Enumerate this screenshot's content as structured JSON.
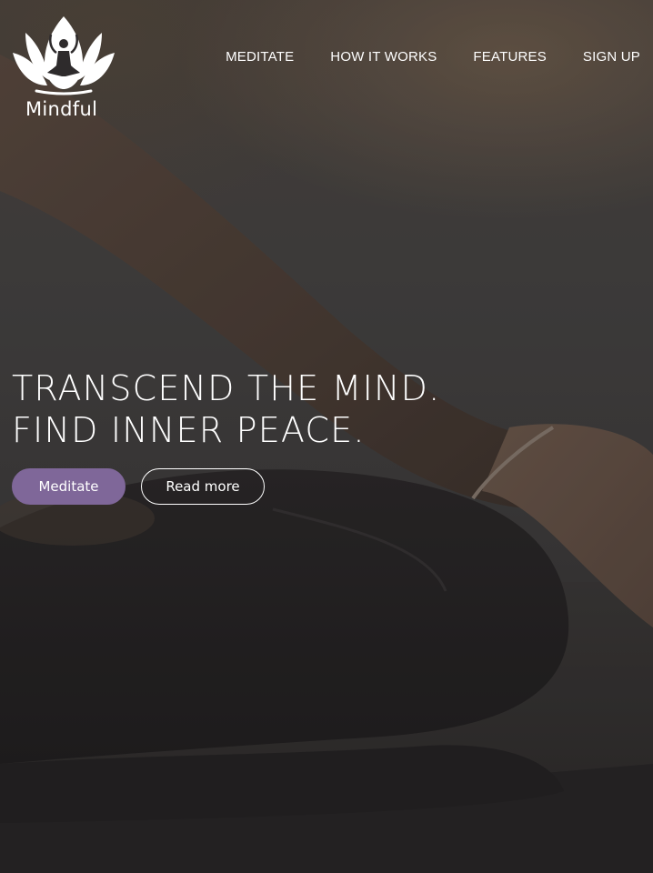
{
  "brand": {
    "name": "Mindful",
    "logo_icon": "lotus-meditation-icon"
  },
  "nav": {
    "items": [
      {
        "label": "MEDITATE"
      },
      {
        "label": "HOW IT WORKS"
      },
      {
        "label": "FEATURES"
      },
      {
        "label": "SIGN UP"
      }
    ]
  },
  "hero": {
    "headline_line1": "TRANSCEND THE MIND.",
    "headline_line2": "FIND INNER PEACE.",
    "primary_button": "Meditate",
    "secondary_button": "Read more",
    "background_image": "person-meditating-cross-legged"
  },
  "colors": {
    "accent": "#7f6799",
    "text": "#ffffff"
  }
}
